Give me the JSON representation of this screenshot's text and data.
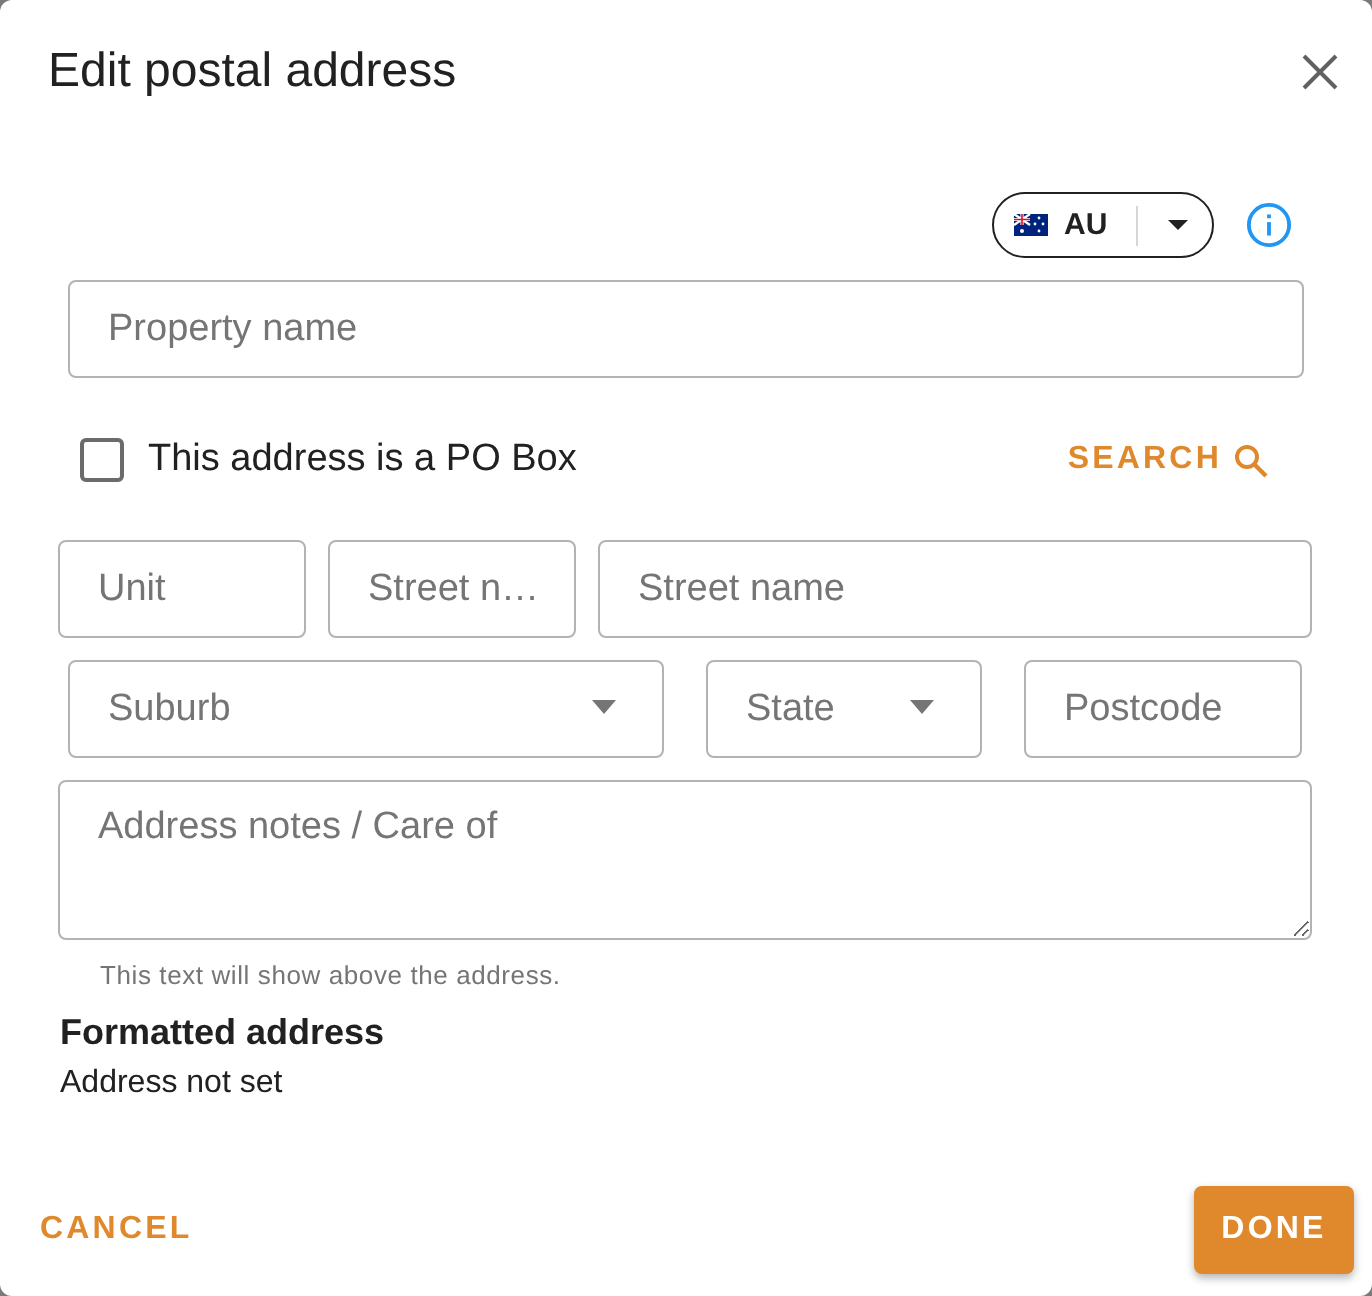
{
  "dialog": {
    "title": "Edit postal address"
  },
  "country_selector": {
    "code": "AU"
  },
  "property_name": {
    "placeholder": "Property name"
  },
  "po_box": {
    "label": "This address is a PO Box",
    "checked": false
  },
  "search": {
    "label": "SEARCH"
  },
  "address_rows": [
    [
      {
        "placeholder": "Unit",
        "kind": "text"
      },
      {
        "placeholder": "Street n…",
        "kind": "text"
      },
      {
        "placeholder": "Street name",
        "kind": "text"
      }
    ],
    [
      {
        "placeholder": "Suburb",
        "kind": "select"
      },
      {
        "placeholder": "State",
        "kind": "select"
      },
      {
        "placeholder": "Postcode",
        "kind": "text"
      }
    ]
  ],
  "notes": {
    "placeholder": "Address notes / Care of",
    "helper": "This text will show above the address."
  },
  "formatted_address": {
    "heading": "Formatted address",
    "value": "Address not set"
  },
  "buttons": [
    {
      "label": "CANCEL",
      "kind": "text"
    },
    {
      "label": "DONE",
      "kind": "contained"
    }
  ]
}
